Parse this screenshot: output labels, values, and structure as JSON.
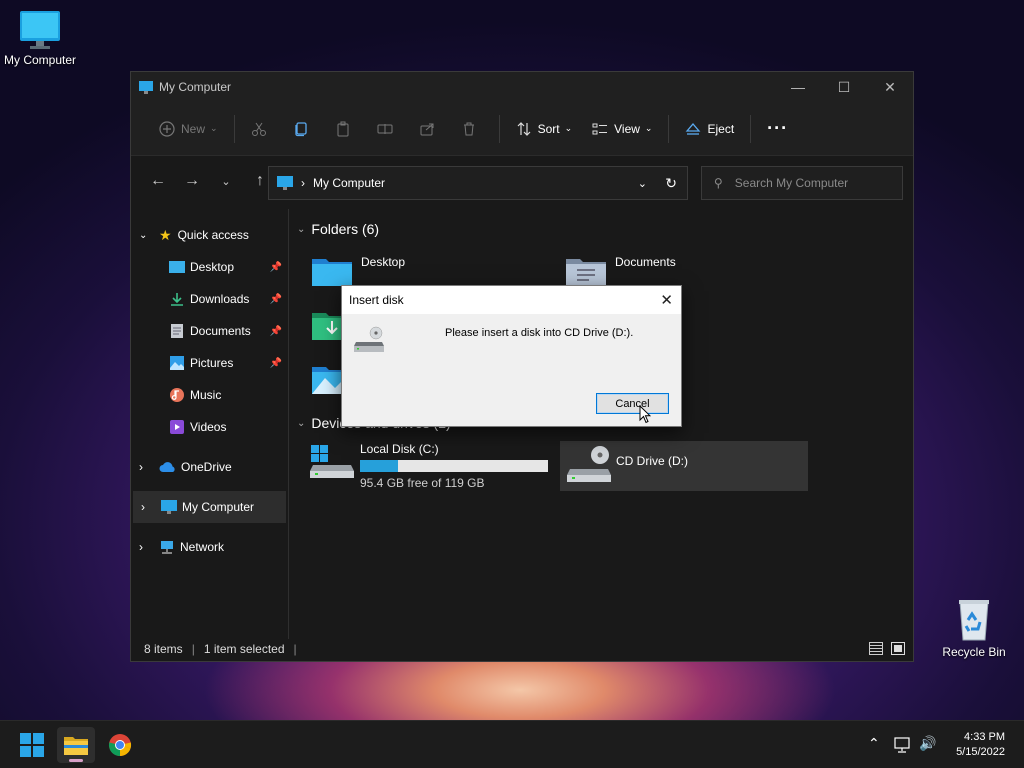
{
  "desktop": {
    "my_computer_label": "My Computer",
    "recycle_bin_label": "Recycle Bin"
  },
  "window": {
    "title": "My Computer",
    "toolbar": {
      "new_label": "New",
      "sort_label": "Sort",
      "view_label": "View",
      "eject_label": "Eject"
    },
    "address": {
      "path": "My Computer",
      "search_placeholder": "Search My Computer"
    },
    "sidebar": {
      "quick_access": "Quick access",
      "items": [
        {
          "label": "Desktop",
          "pinned": true
        },
        {
          "label": "Downloads",
          "pinned": true
        },
        {
          "label": "Documents",
          "pinned": true
        },
        {
          "label": "Pictures",
          "pinned": true
        },
        {
          "label": "Music",
          "pinned": false
        },
        {
          "label": "Videos",
          "pinned": false
        }
      ],
      "onedrive": "OneDrive",
      "my_computer": "My Computer",
      "network": "Network"
    },
    "content": {
      "folders_header": "Folders (6)",
      "folders": [
        "Desktop",
        "Documents"
      ],
      "devices_header": "Devices and drives (2)",
      "drives": [
        {
          "name": "Local Disk (C:)",
          "free_text": "95.4 GB free of 119 GB",
          "used_fraction": 0.2
        },
        {
          "name": "CD Drive (D:)"
        }
      ]
    },
    "status": {
      "items": "8 items",
      "selected": "1 item selected"
    }
  },
  "dialog": {
    "title": "Insert disk",
    "message": "Please insert a disk into CD Drive (D:).",
    "cancel_label": "Cancel"
  },
  "taskbar": {
    "time": "4:33 PM",
    "date": "5/15/2022"
  },
  "colors": {
    "accent": "#0078d7",
    "drive_bar": "#26a0da",
    "selection": "#2d2d2d"
  }
}
